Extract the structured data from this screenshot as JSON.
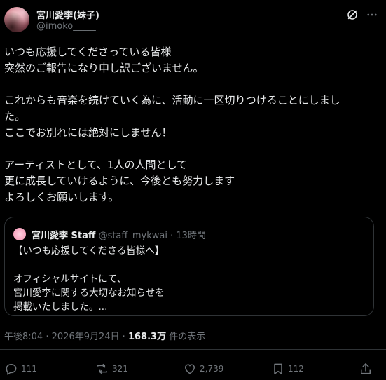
{
  "author": {
    "display_name": "宮川愛李(妹子)",
    "handle": "@imoko_____"
  },
  "tweet": {
    "lines": [
      "いつも応援してくださっている皆様",
      "突然のご報告になり申し訳ございません。",
      "",
      "これからも音楽を続けていく為に、活動に一区切りつけることにしまし",
      "た。",
      "ここでお別れには絶対にしません！",
      "",
      "アーティストとして、1人の人間として",
      "更に成長していけるように、今後とも努力します",
      "よろしくお願いします。"
    ]
  },
  "quote": {
    "name": "宮川愛李 Staff",
    "handle": "@staff_mykwai",
    "separator": "·",
    "time": "13時間",
    "lines": [
      "【いつも応援してくださる皆様へ】",
      "",
      "オフィシャルサイトにて、",
      "宮川愛李に関する大切なお知らせを",
      "掲載いたしました。..."
    ]
  },
  "meta": {
    "time": "午後8:04",
    "separator1": "·",
    "date": "2026年9月24日",
    "separator2": "·",
    "views_count": "168.3万",
    "views_label": "件の表示"
  },
  "actions": {
    "replies": "111",
    "reposts": "321",
    "likes": "2,739",
    "bookmarks": "112"
  },
  "icons": {
    "grok": "grok-icon",
    "more": "more-icon",
    "reply": "reply-icon",
    "repost": "repost-icon",
    "like": "heart-icon",
    "bookmark": "bookmark-icon",
    "share": "share-icon"
  },
  "colors": {
    "background": "#000000",
    "text": "#e7e9ea",
    "muted": "#71767b",
    "border": "#2f3336"
  }
}
